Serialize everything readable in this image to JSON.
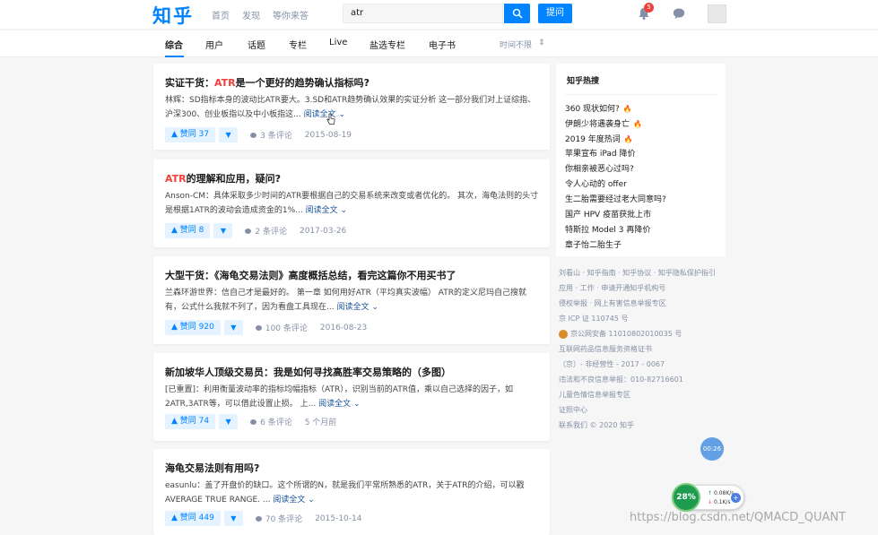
{
  "header": {
    "logo": "知乎",
    "nav": [
      "首页",
      "发现",
      "等你来答"
    ],
    "search_value": "atr",
    "ask_label": "提问",
    "notification_count": "5"
  },
  "tabs": {
    "items": [
      "综合",
      "用户",
      "话题",
      "专栏",
      "Live",
      "盐选专栏",
      "电子书"
    ],
    "active": "综合",
    "time_filter": "时间不限"
  },
  "results": [
    {
      "title_pre": "实证干货：",
      "title_hl": "ATR",
      "title_post": "是一个更好的趋势确认指标吗?",
      "line1": "林辉：SD指标本身的波动比ATR要大。3.SD和ATR趋势确认效果的实证分析 这一部分我们对上证综指、",
      "line2": "沪深300、创业板指以及中小板指这...",
      "read_more": "阅读全文",
      "votes": "赞同 37",
      "comments": "3 条评论",
      "date": "2015-08-19"
    },
    {
      "title_hl": "ATR",
      "title_post": "的理解和应用，疑问?",
      "line1": "Anson-CM：具体采取多少时间的ATR要根据自己的交易系统来改变或者优化的。 其次，海龟法则的头寸",
      "line2": "是根据1ATR的波动会造成资金的1%...",
      "read_more": "阅读全文",
      "votes": "赞同 8",
      "comments": "2 条评论",
      "date": "2017-03-26"
    },
    {
      "title": "大型干货：《海龟交易法则》高度概括总结，看完这篇你不用买书了",
      "line1": "兰森环游世界：信自己才是最好的。 第一章 如何用好ATR（平均真实波幅） ATR的定义尼玛自己搜就",
      "line2": "有，公式什么我就不列了，因为看盘工具现在...",
      "read_more": "阅读全文",
      "votes": "赞同 920",
      "comments": "100 条评论",
      "date": "2016-08-23"
    },
    {
      "title": "新加坡华人顶级交易员：我是如何寻找高胜率交易策略的（多图）",
      "line1": "[已重置]：利用衡量波动率的指标均幅指标（ATR），识别当前的ATR值，乘以自己选择的因子，如",
      "line2": "2ATR,3ATR等，可以借此设置止损。 上...",
      "read_more": "阅读全文",
      "votes": "赞同 74",
      "comments": "6 条评论",
      "date": "5 个月前"
    },
    {
      "title": "海龟交易法则有用吗?",
      "line1": "easunlu：盖了开盘价的缺口。这个所谓的N，就是我们平常所熟悉的ATR，关于ATR的介绍，可以戳",
      "line2": "AVERAGE TRUE RANGE. ...",
      "read_more": "阅读全文",
      "votes": "赞同 449",
      "comments": "70 条评论",
      "date": "2015-10-14"
    }
  ],
  "hot": {
    "title": "知乎热搜",
    "items": [
      "360 现状如何?",
      "伊朗少将遇袭身亡",
      "2019 年度热词",
      "苹果宣布 iPad 降价",
      "你相亲被恶心过吗?",
      "令人心动的 offer",
      "生二胎需要经过老大同意吗?",
      "国产 HPV 疫苗获批上市",
      "特斯拉 Model 3 再降价",
      "章子怡二胎生子"
    ]
  },
  "footer": [
    "刘看山 · 知乎指南 · 知乎协议 · 知乎隐私保护指引",
    "应用 · 工作 · 申请开通知乎机构号",
    "侵权举报 · 网上有害信息举报专区",
    "京 ICP 证 110745 号",
    "京公网安备 11010802010035 号",
    "互联网药品信息服务资格证书",
    "（京）- 非经营性 - 2017 - 0067",
    "违法和不良信息举报：010-82716601",
    "儿童色情信息举报专区",
    "证照中心",
    "联系我们 © 2020 知乎"
  ],
  "float_widget": "00:26",
  "net": {
    "percent": "28%",
    "up": "0.08K/s",
    "down": "0.1K/s"
  },
  "watermark": "https://blog.csdn.net/QMACD_QUANT"
}
